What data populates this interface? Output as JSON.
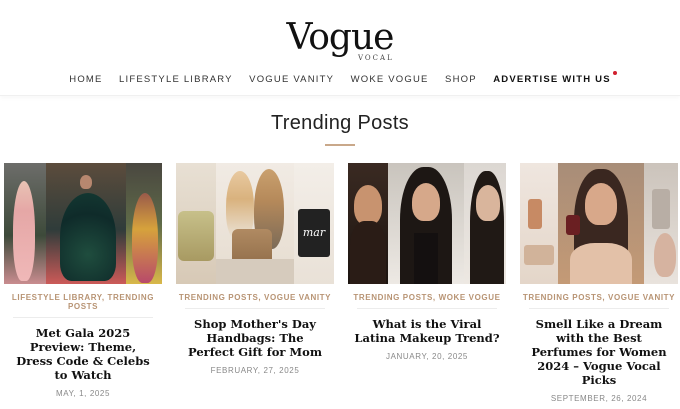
{
  "brand": {
    "name": "Vogue",
    "sub": "VOCAL"
  },
  "nav": [
    {
      "label": "HOME"
    },
    {
      "label": "LIFESTYLE LIBRARY"
    },
    {
      "label": "VOGUE VANITY"
    },
    {
      "label": "WOKE VOGUE"
    },
    {
      "label": "SHOP"
    },
    {
      "label": "ADVERTISE WITH US"
    }
  ],
  "section": {
    "title": "Trending Posts"
  },
  "posts": [
    {
      "categories": "LIFESTYLE LIBRARY, TRENDING POSTS",
      "title": "Met Gala 2025 Preview: Theme, Dress Code & Celebs to Watch",
      "date": "MAY, 1, 2025"
    },
    {
      "categories": "TRENDING POSTS, VOGUE VANITY",
      "title": "Shop Mother's Day Handbags: The Perfect Gift for Mom",
      "date": "FEBRUARY, 27, 2025"
    },
    {
      "categories": "TRENDING POSTS, WOKE VOGUE",
      "title": "What is the Viral Latina Makeup Trend?",
      "date": "JANUARY, 20, 2025"
    },
    {
      "categories": "TRENDING POSTS, VOGUE VANITY",
      "title": "Smell Like a Dream with the Best Perfumes for Women 2024 – Vogue Vocal Picks",
      "date": "SEPTEMBER, 26, 2024"
    }
  ],
  "thumb2_bag_text": "mar",
  "colors": {
    "accent": "#b89474",
    "rule": "#c9a88a",
    "dot": "#d0202e"
  }
}
